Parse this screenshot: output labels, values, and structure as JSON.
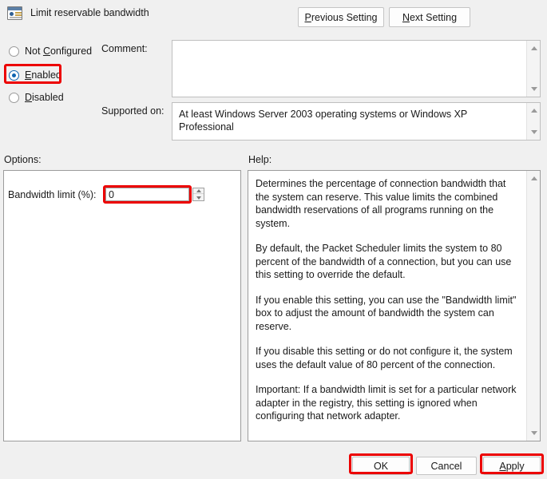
{
  "header": {
    "title": "Limit reservable bandwidth",
    "icon": "policy-setting-icon",
    "previous_setting_label": "Previous Setting",
    "previous_setting_accesskey": "P",
    "next_setting_label": "Next Setting",
    "next_setting_accesskey": "N"
  },
  "state_options": [
    {
      "label": "Not Configured",
      "accesskey": "C",
      "selected": false,
      "highlighted": false
    },
    {
      "label": "Enabled",
      "accesskey": "E",
      "selected": true,
      "highlighted": true
    },
    {
      "label": "Disabled",
      "accesskey": "D",
      "selected": false,
      "highlighted": false
    }
  ],
  "fields": {
    "comment_label": "Comment:",
    "comment_value": "",
    "supported_on_label": "Supported on:",
    "supported_on_value": "At least Windows Server 2003 operating systems or Windows XP Professional"
  },
  "options": {
    "label": "Options:",
    "bandwidth_limit_label": "Bandwidth limit (%):",
    "bandwidth_limit_value": "0"
  },
  "help": {
    "label": "Help:",
    "paragraphs": [
      "Determines the percentage of connection bandwidth that the system can reserve. This value limits the combined bandwidth reservations of all programs running on the system.",
      "By default, the Packet Scheduler limits the system to 80 percent of the bandwidth of a connection, but you can use this setting to override the default.",
      "If you enable this setting, you can use the \"Bandwidth limit\" box to adjust the amount of bandwidth the system can reserve.",
      "If you disable this setting or do not configure it, the system uses the default value of 80 percent of the connection.",
      "Important: If a bandwidth limit is set for a particular network adapter in the registry, this setting is ignored when configuring that network adapter."
    ]
  },
  "footer": {
    "ok_label": "OK",
    "cancel_label": "Cancel",
    "apply_label": "Apply",
    "apply_accesskey": "A"
  },
  "colors": {
    "highlight": "#ec0000",
    "radio_selected": "#1064b0",
    "dialog_background": "#f0f0f0"
  }
}
